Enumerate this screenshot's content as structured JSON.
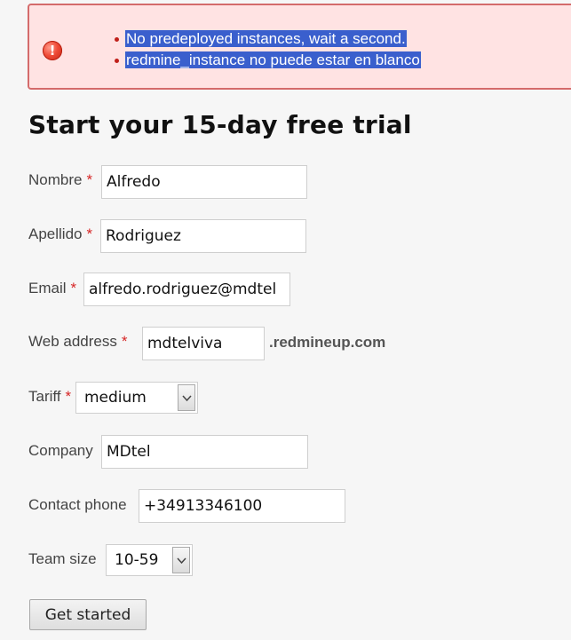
{
  "errors": {
    "icon": "exclamation-icon",
    "messages": [
      "No predeployed instances, wait a second.",
      "redmine_instance no puede estar en blanco"
    ]
  },
  "title": "Start your 15-day free trial",
  "form": {
    "required_mark": "*",
    "nombre": {
      "label": "Nombre",
      "value": "Alfredo"
    },
    "apellido": {
      "label": "Apellido",
      "value": "Rodriguez"
    },
    "email": {
      "label": "Email",
      "value": "alfredo.rodriguez@mdtel"
    },
    "web_address": {
      "label": "Web address",
      "value": "mdtelviva",
      "suffix": ".redmineup.com"
    },
    "tariff": {
      "label": "Tariff",
      "selected": "medium"
    },
    "company": {
      "label": "Company",
      "value": "MDtel"
    },
    "contact_phone": {
      "label": "Contact phone",
      "value": "+34913346100"
    },
    "team_size": {
      "label": "Team size",
      "selected": "10-59"
    },
    "submit_label": "Get started"
  },
  "colors": {
    "error_background": "#ffe3e3",
    "error_border": "#d46b6b",
    "selection": "#3a5fcd",
    "required": "#d62525"
  }
}
